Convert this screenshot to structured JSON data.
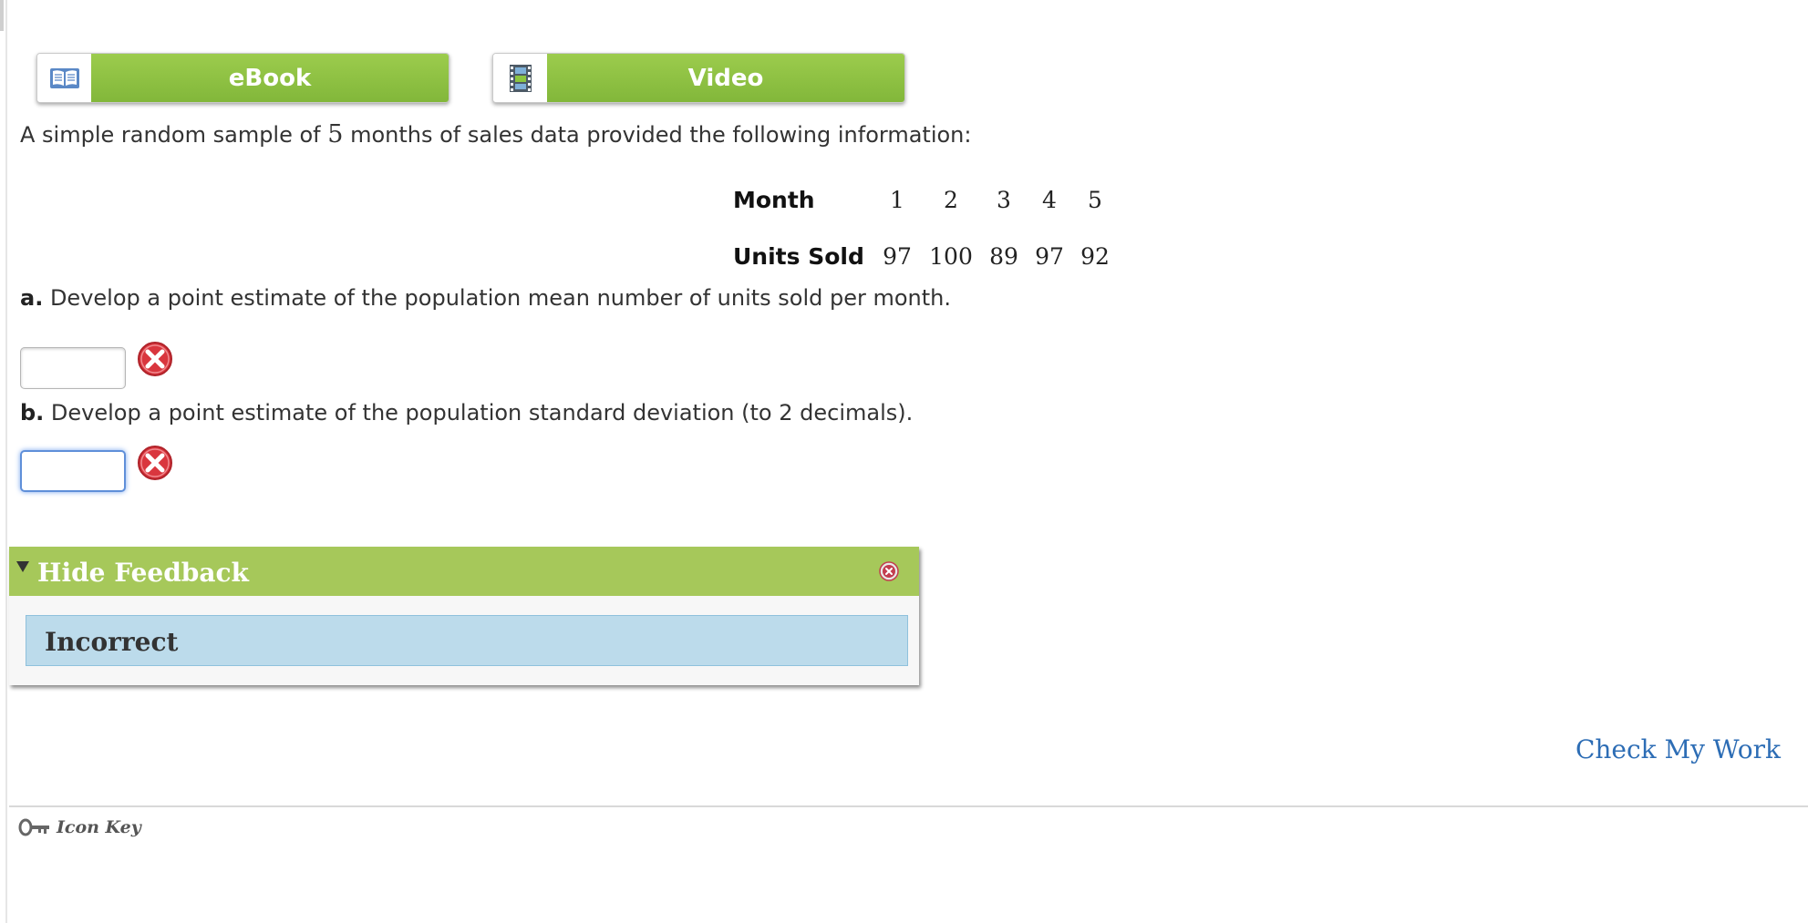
{
  "resources": {
    "ebook_label": "eBook",
    "video_label": "Video"
  },
  "question": {
    "intro_before": "A simple random sample of ",
    "intro_number": "5",
    "intro_after": " months of sales data provided the following information:",
    "table": {
      "row_headers": [
        "Month",
        "Units Sold"
      ],
      "months": [
        "1",
        "2",
        "3",
        "4",
        "5"
      ],
      "units_sold": [
        "97",
        "100",
        "89",
        "97",
        "92"
      ]
    },
    "part_a": {
      "letter": "a.",
      "text": " Develop a point estimate of the population mean number of units sold per month.",
      "answer_value": ""
    },
    "part_b": {
      "letter": "b.",
      "text": " Develop a point estimate of the population standard deviation (to 2 decimals).",
      "answer_value": ""
    }
  },
  "feedback": {
    "toggle_label": "Hide Feedback",
    "status": "Incorrect"
  },
  "footer": {
    "check_label": "Check My Work",
    "icon_key_label": "Icon Key"
  },
  "colors": {
    "button_green": "#8cc63f",
    "feedback_green": "#a6c85a",
    "feedback_status_bg": "#bcdbeb",
    "link_blue": "#2d6db5",
    "error_red": "#d9363e"
  },
  "icons": {
    "ebook": "book-icon",
    "video": "film-icon",
    "wrong": "x-circle-icon",
    "key": "key-icon"
  }
}
